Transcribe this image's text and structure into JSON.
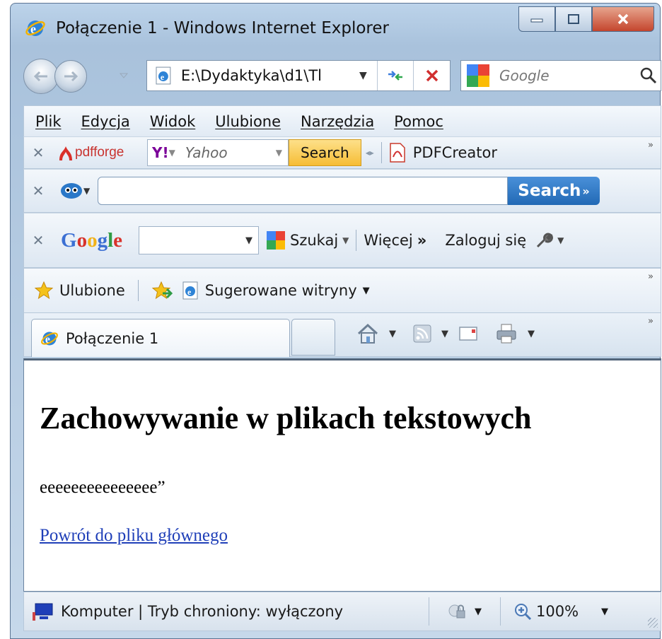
{
  "window": {
    "title": "Połączenie 1 - Windows Internet Explorer"
  },
  "address": {
    "value": "E:\\Dydaktyka\\d1\\Tl"
  },
  "search": {
    "placeholder": "Google"
  },
  "menu": [
    "Plik",
    "Edycja",
    "Widok",
    "Ulubione",
    "Narzędzia",
    "Pomoc"
  ],
  "pdfforge_toolbar": {
    "brand": "pdfforge",
    "yahoo_logo": "Y!",
    "yahoo_text": "Yahoo",
    "search_label": "Search",
    "pdfcreator_label": "PDFCreator"
  },
  "messenger_toolbar": {
    "search_label": "Search"
  },
  "google_toolbar": {
    "brand": "Google",
    "szukaj_label": "Szukaj",
    "wiecej_label": "Więcej",
    "login_label": "Zaloguj się"
  },
  "favorites": {
    "ulubione_label": "Ulubione",
    "suggested_label": "Sugerowane witryny"
  },
  "tab": {
    "title": "Połączenie 1"
  },
  "page": {
    "heading": "Zachowywanie w plikach tekstowych",
    "text": "eeeeeeeeeeeeeee”",
    "link": "Powrót do pliku głównego"
  },
  "status": {
    "text": "Komputer | Tryb chroniony: wyłączony",
    "zoom": "100%"
  },
  "colors": {
    "accent": "#2169b5",
    "link": "#1f3fb8",
    "chrome": "#bcd3ea"
  }
}
